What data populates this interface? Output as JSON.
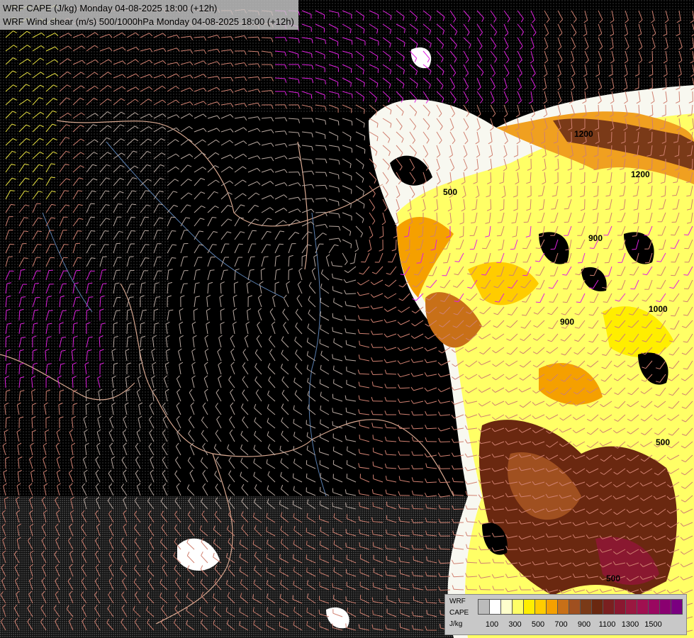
{
  "header": {
    "line1": "WRF CAPE (J/kg) Monday 04-08-2025 18:00 (+12h)",
    "line2": "WRF Wind shear (m/s) 500/1000hPa Monday 04-08-2025 18:00 (+12h)"
  },
  "legend": {
    "model": "WRF",
    "variable": "CAPE",
    "unit": "J/kg",
    "colors": [
      "#ffffff",
      "#ffffcc",
      "#ffff66",
      "#ffee00",
      "#ffcc00",
      "#f5a000",
      "#c87018",
      "#a05020",
      "#7a3a18",
      "#6a2810",
      "#7a2020",
      "#8a1830",
      "#9a1840",
      "#a01050",
      "#9a0860",
      "#8a0070",
      "#7a0080"
    ],
    "tick_labels": [
      "100",
      "300",
      "500",
      "700",
      "900",
      "1100",
      "1300",
      "1500"
    ]
  },
  "map_labels": {
    "contours": [
      "500",
      "900",
      "1200",
      "500",
      "1000",
      "900",
      "1200",
      "500"
    ]
  }
}
